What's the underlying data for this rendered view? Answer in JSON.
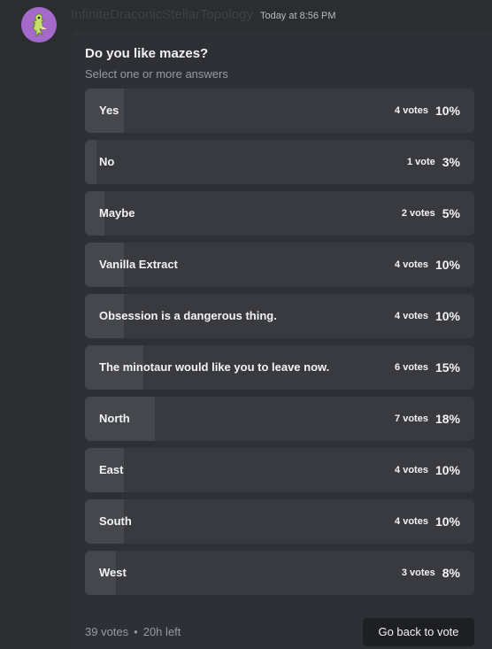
{
  "message": {
    "username": "InfiniteDraconicStellarTopology",
    "timestamp": "Today at 8:56 PM",
    "avatar_icon": "creature-avatar-icon",
    "username_color": "#3f4147"
  },
  "poll": {
    "question": "Do you like mazes?",
    "subtitle": "Select one or more answers",
    "answers": [
      {
        "label": "Yes",
        "votes": "4 votes",
        "percent": "10%",
        "share": 0.1
      },
      {
        "label": "No",
        "votes": "1 vote",
        "percent": "3%",
        "share": 0.03
      },
      {
        "label": "Maybe",
        "votes": "2 votes",
        "percent": "5%",
        "share": 0.05
      },
      {
        "label": "Vanilla Extract",
        "votes": "4 votes",
        "percent": "10%",
        "share": 0.1
      },
      {
        "label": "Obsession is a dangerous thing.",
        "votes": "4 votes",
        "percent": "10%",
        "share": 0.1
      },
      {
        "label": "The minotaur would like you to leave now.",
        "votes": "6 votes",
        "percent": "15%",
        "share": 0.15
      },
      {
        "label": "North",
        "votes": "7 votes",
        "percent": "18%",
        "share": 0.18
      },
      {
        "label": "East",
        "votes": "4 votes",
        "percent": "10%",
        "share": 0.1
      },
      {
        "label": "South",
        "votes": "4 votes",
        "percent": "10%",
        "share": 0.1
      },
      {
        "label": "West",
        "votes": "3 votes",
        "percent": "8%",
        "share": 0.08
      }
    ],
    "total_votes": "39 votes",
    "separator": "•",
    "time_left": "20h left",
    "button_label": "Go back to vote"
  },
  "colors": {
    "card_bg": "#2e3035",
    "answer_bg": "#393a40",
    "answer_fill": "#45474d",
    "button_bg": "#1e1f22"
  }
}
